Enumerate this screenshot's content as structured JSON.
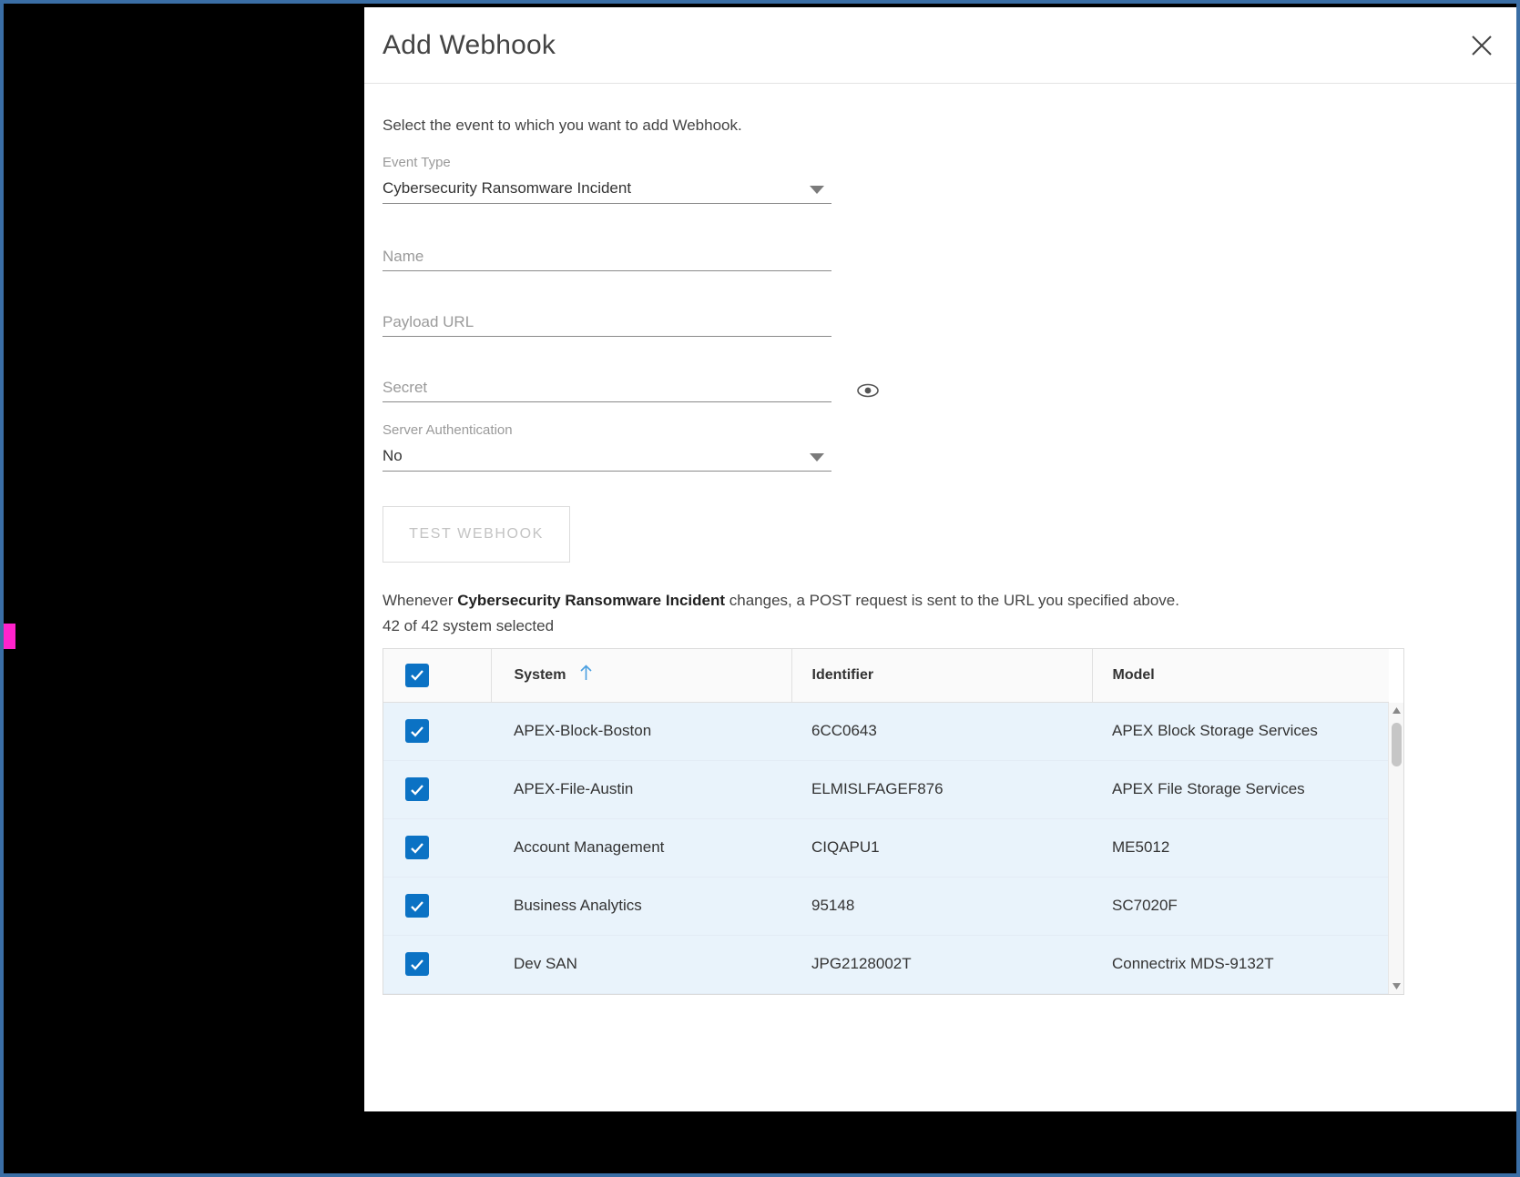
{
  "dialog": {
    "title": "Add Webhook",
    "close_icon": "close-icon",
    "intro": "Select the event to which you want to add Webhook."
  },
  "form": {
    "event_type": {
      "label": "Event Type",
      "value": "Cybersecurity Ransomware Incident",
      "caret_icon": "chevron-down-icon"
    },
    "name": {
      "label": "Name",
      "placeholder": "Name",
      "value": ""
    },
    "payload_url": {
      "label": "Payload URL",
      "placeholder": "Payload URL",
      "value": ""
    },
    "secret": {
      "label": "Secret",
      "placeholder": "Secret",
      "value": "",
      "reveal_icon": "eye-icon"
    },
    "server_authentication": {
      "label": "Server Authentication",
      "value": "No",
      "caret_icon": "chevron-down-icon"
    },
    "test_button": "TEST WEBHOOK"
  },
  "description": {
    "prefix": "Whenever ",
    "event_name": "Cybersecurity Ransomware Incident",
    "suffix": " changes, a POST request is sent to the URL you specified above.",
    "selection_summary": "42 of 42 system selected"
  },
  "table": {
    "select_all_checked": true,
    "sort_column": "System",
    "sort_direction": "ascending",
    "sort_icon": "arrow-up-icon",
    "columns": [
      "System",
      "Identifier",
      "Model"
    ],
    "rows": [
      {
        "checked": true,
        "system": "APEX-Block-Boston",
        "identifier": "6CC0643",
        "model": "APEX Block Storage Services"
      },
      {
        "checked": true,
        "system": "APEX-File-Austin",
        "identifier": "ELMISLFAGEF876",
        "model": "APEX File Storage Services"
      },
      {
        "checked": true,
        "system": "Account Management",
        "identifier": "CIQAPU1",
        "model": "ME5012"
      },
      {
        "checked": true,
        "system": "Business Analytics",
        "identifier": "95148",
        "model": "SC7020F"
      },
      {
        "checked": true,
        "system": "Dev SAN",
        "identifier": "JPG2128002T",
        "model": "Connectrix MDS-9132T"
      }
    ],
    "scrollbar": {
      "up_icon": "chevron-up-icon",
      "down_icon": "chevron-down-icon"
    }
  },
  "colors": {
    "accent": "#0b72c4",
    "row_selected": "#e9f3fb",
    "window_border": "#3a6ea5",
    "marker": "#ff22cc"
  }
}
